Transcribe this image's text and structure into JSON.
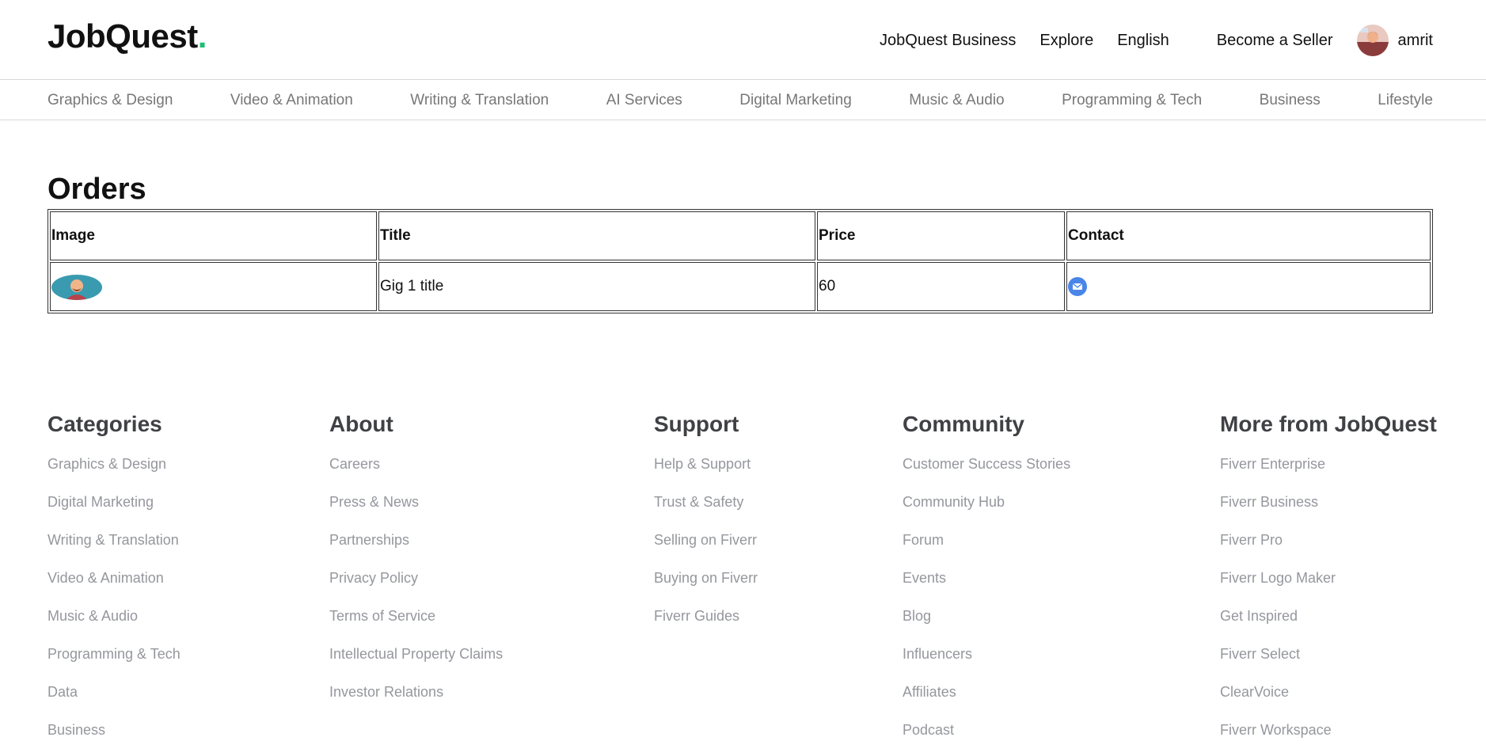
{
  "header": {
    "logo_text": "JobQuest",
    "logo_dot": ".",
    "links": [
      "JobQuest Business",
      "Explore",
      "English"
    ],
    "become_seller": "Become a Seller",
    "username": "amrit"
  },
  "categories_nav": [
    "Graphics & Design",
    "Video & Animation",
    "Writing & Translation",
    "AI Services",
    "Digital Marketing",
    "Music & Audio",
    "Programming & Tech",
    "Business",
    "Lifestyle"
  ],
  "orders": {
    "title": "Orders",
    "columns": [
      "Image",
      "Title",
      "Price",
      "Contact"
    ],
    "rows": [
      {
        "title": "Gig 1 title",
        "price": "60",
        "contact_icon": "mail-icon"
      }
    ]
  },
  "footer": {
    "columns": [
      {
        "heading": "Categories",
        "items": [
          "Graphics & Design",
          "Digital Marketing",
          "Writing & Translation",
          "Video & Animation",
          "Music & Audio",
          "Programming & Tech",
          "Data",
          "Business"
        ]
      },
      {
        "heading": "About",
        "items": [
          "Careers",
          "Press & News",
          "Partnerships",
          "Privacy Policy",
          "Terms of Service",
          "Intellectual Property Claims",
          "Investor Relations"
        ]
      },
      {
        "heading": "Support",
        "items": [
          "Help & Support",
          "Trust & Safety",
          "Selling on Fiverr",
          "Buying on Fiverr",
          "Fiverr Guides"
        ]
      },
      {
        "heading": "Community",
        "items": [
          "Customer Success Stories",
          "Community Hub",
          "Forum",
          "Events",
          "Blog",
          "Influencers",
          "Affiliates",
          "Podcast"
        ]
      },
      {
        "heading": "More from JobQuest",
        "items": [
          "Fiverr Enterprise",
          "Fiverr Business",
          "Fiverr Pro",
          "Fiverr Logo Maker",
          "Get Inspired",
          "Fiverr Select",
          "ClearVoice",
          "Fiverr Workspace"
        ]
      }
    ]
  },
  "colors": {
    "accent": "#1dbf73",
    "mail_icon": "#4a86e8"
  }
}
